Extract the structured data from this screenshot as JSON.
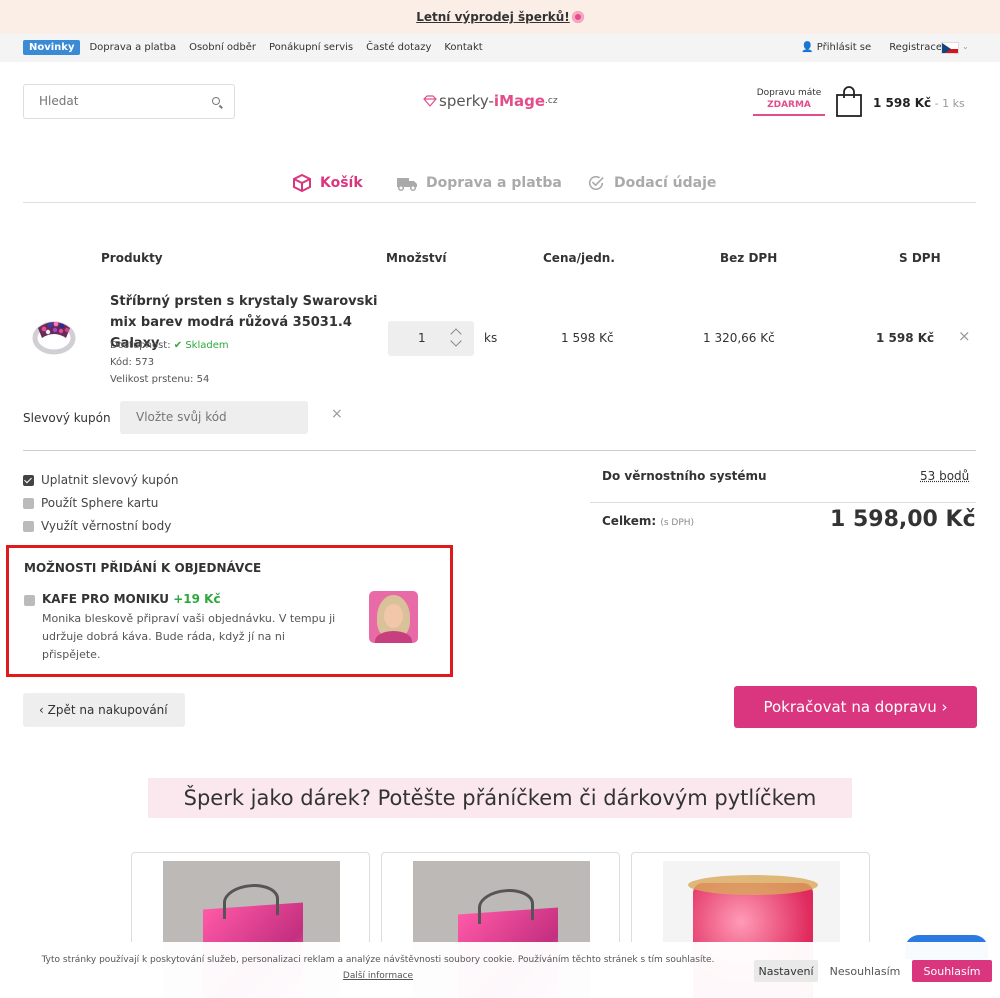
{
  "promo": {
    "text": "Letní výprodej šperků!"
  },
  "nav": {
    "items": [
      "Novinky",
      "Doprava a platba",
      "Osobní odběr",
      "Ponákupní servis",
      "Časté dotazy",
      "Kontakt"
    ],
    "login": "Přihlásit se",
    "register": "Registrace"
  },
  "search": {
    "placeholder": "Hledat"
  },
  "logo": {
    "part1": "sperky-",
    "part2": "iMage",
    "part3": ".cz"
  },
  "delivery": {
    "line1": "Dopravu máte",
    "line2": "ZDARMA"
  },
  "cart_summary": {
    "price": "1 598 Kč",
    "qty": " - 1 ks"
  },
  "steps": {
    "cart": "Košík",
    "shipping": "Doprava a platba",
    "details": "Dodací údaje"
  },
  "table_headers": {
    "products": "Produkty",
    "qty": "Množství",
    "unit": "Cena/jedn.",
    "nodph": "Bez DPH",
    "dph": "S DPH"
  },
  "product": {
    "name": "Stříbrný prsten s krystaly Swarovski mix barev modrá růžová 35031.4 Galaxy",
    "availability_label": "Dostupnost:",
    "availability_value": "✔ Skladem",
    "code": "Kód: 573",
    "size": "Velikost prstenu: 54",
    "qty": "1",
    "unit": "ks",
    "unit_price": "1 598 Kč",
    "price_nodph": "1 320,66 Kč",
    "price_dph": "1 598 Kč",
    "remove": "×"
  },
  "coupon": {
    "label": "Slevový kupón",
    "placeholder": "Vložte svůj kód",
    "clear": "×"
  },
  "options": [
    "Uplatnit slevový kupón",
    "Použít Sphere kartu",
    "Využít věrnostní body"
  ],
  "loyalty": {
    "label": "Do věrnostního systému",
    "value": "53 bodů"
  },
  "total": {
    "label": "Celkem:",
    "note": "(s DPH)",
    "value": "1 598,00 Kč"
  },
  "addon": {
    "heading": "MOŽNOSTI PŘIDÁNÍ K OBJEDNÁVCE",
    "title": "KAFE PRO MONIKU",
    "price": "+19 Kč",
    "desc": "Monika bleskově připraví vaši objednávku. V tempu ji udržuje dobrá káva. Bude ráda, když jí na ni přispějete."
  },
  "buttons": {
    "back": "‹  Zpět na nakupování",
    "continue": "Pokračovat na dopravu  ›"
  },
  "gifts": {
    "title": "Šperk jako dárek? Potěšte přáníčkem či dárkovým pytlíčkem"
  },
  "cookie": {
    "text": "Tyto stránky používají k poskytování služeb, personalizaci reklam a analýze návštěvnosti soubory cookie. Používáním těchto stránek s tím souhlasíte.",
    "more": "Další informace",
    "settings": "Nastavení",
    "decline": "Nesouhlasím",
    "accept": "Souhlasím"
  },
  "colors": {
    "accent": "#d9367f",
    "highlight": "#e0191d",
    "nav_badge": "#3a8ad6",
    "ok": "#2ea83b"
  }
}
